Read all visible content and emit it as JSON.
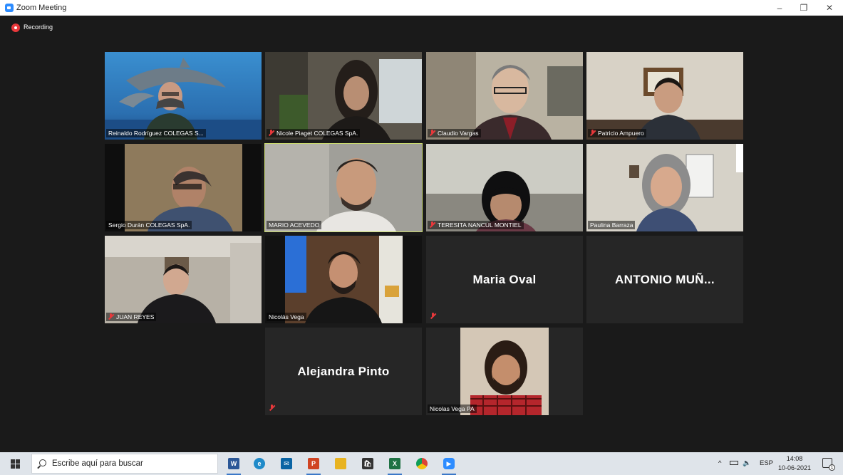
{
  "window": {
    "title": "Zoom Meeting",
    "minimize": "–",
    "maximize": "❐",
    "close": "✕"
  },
  "recording": {
    "label": "Recording"
  },
  "participants": [
    {
      "name": "Reinaldo Rodríguez  COLEGAS S...",
      "video": true,
      "muted": false,
      "background": "dolphins-ocean"
    },
    {
      "name": "Nicole Piaget COLEGAS SpA.",
      "video": true,
      "muted": true,
      "background": "room"
    },
    {
      "name": "Claudio Vargas",
      "video": true,
      "muted": true,
      "background": "office"
    },
    {
      "name": "Patricio Ampuero",
      "video": true,
      "muted": true,
      "background": "office-frame"
    },
    {
      "name": "Sergio Durán COLEGAS SpA.",
      "video": true,
      "muted": false,
      "background": "dark-room"
    },
    {
      "name": "MARIO ACEVEDO",
      "video": true,
      "muted": false,
      "active_speaker": true,
      "background": "white-wall"
    },
    {
      "name": "TERESITA NANCUL MONTIEL",
      "video": true,
      "muted": true,
      "background": "light-room"
    },
    {
      "name": "Paulina Barraza",
      "video": true,
      "muted": false,
      "background": "office-whiteboard"
    },
    {
      "name": "JUAN REYES",
      "video": true,
      "muted": true,
      "background": "home-office"
    },
    {
      "name": "Nicolás Vega",
      "video": true,
      "muted": false,
      "background": "blue-wall"
    },
    {
      "name": "Maria Oval",
      "video": false,
      "muted": true
    },
    {
      "name": "ANTONIO  MUÑ...",
      "video": false,
      "muted": false
    },
    {
      "name": "Alejandra Pinto",
      "video": false,
      "muted": true
    },
    {
      "name": "Nicolas Vega PA",
      "video": true,
      "muted": false,
      "background": "phone-portrait"
    }
  ],
  "taskbar": {
    "search_placeholder": "Escribe aquí para buscar",
    "apps": [
      {
        "name": "word-icon",
        "label": "W",
        "color": "#2b5797",
        "running": true
      },
      {
        "name": "edge-icon",
        "label": "e",
        "color": "#1f8ac9",
        "running": false
      },
      {
        "name": "mail-icon",
        "label": "✉",
        "color": "#0a64a4",
        "running": false
      },
      {
        "name": "powerpoint-icon",
        "label": "P",
        "color": "#d04423",
        "running": true
      },
      {
        "name": "file-explorer-icon",
        "label": "",
        "color": "#e8b321",
        "running": false
      },
      {
        "name": "store-icon",
        "label": "🛍",
        "color": "#333333",
        "running": false
      },
      {
        "name": "excel-icon",
        "label": "X",
        "color": "#1f7244",
        "running": true
      },
      {
        "name": "chrome-icon",
        "label": "",
        "color": "#db4437",
        "running": false
      },
      {
        "name": "zoom-icon",
        "label": "▶",
        "color": "#2d8cff",
        "running": true
      }
    ],
    "tray": {
      "chevron": "^",
      "language": "ESP",
      "time": "14:08",
      "date": "10-06-2021",
      "notifications": "1"
    }
  },
  "colors": {
    "meeting_bg": "#1a1a1a",
    "tile_bg": "#262626",
    "active_speaker_border": "#c9d970",
    "muted_red": "#e8383b",
    "zoom_blue": "#2d8cff"
  }
}
